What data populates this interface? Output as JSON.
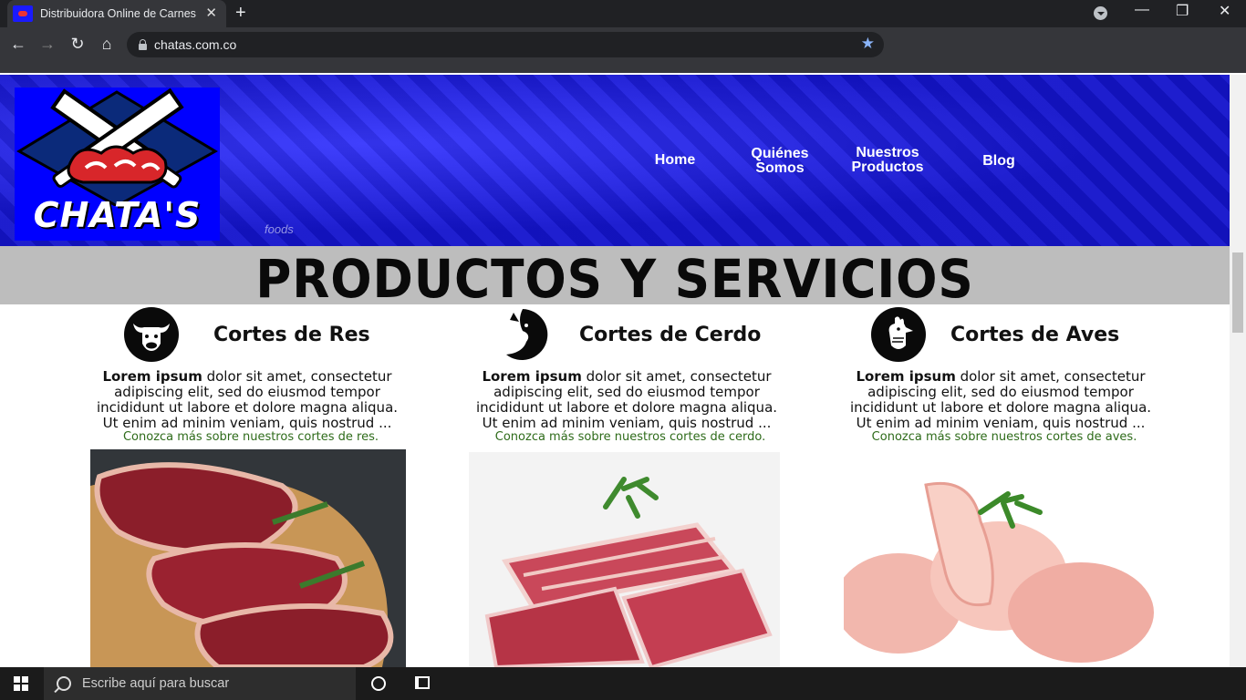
{
  "browser": {
    "tab_title": "Distribuidora Online de Carnes",
    "tab_close": "✕",
    "new_tab": "+",
    "url": "chatas.com.co",
    "window_controls": {
      "minimize": "—",
      "maximize": "❐",
      "close": "✕"
    }
  },
  "site": {
    "logo_text": "CHATA'S",
    "nav": [
      {
        "label": "Home"
      },
      {
        "label": "Quiénes\nSomos"
      },
      {
        "label": "Nuestros\nProductos"
      },
      {
        "label": "Blog"
      }
    ],
    "hero_ghost_text": "foods",
    "section_title": "PRODUCTOS Y SERVICIOS",
    "cards": [
      {
        "title": "Cortes de Res",
        "icon": "cow-icon",
        "desc_bold": "Lorem ipsum",
        "desc": " dolor sit amet, consectetur adipiscing elit, sed do eiusmod tempor incididunt ut labore et dolore magna aliqua. Ut enim ad minim veniam, quis nostrud ...",
        "link": "Conozca más sobre nuestros cortes de res."
      },
      {
        "title": "Cortes de Cerdo",
        "icon": "pig-icon",
        "desc_bold": "Lorem ipsum",
        "desc": " dolor sit amet, consectetur adipiscing elit, sed do eiusmod tempor incididunt ut labore et dolore magna aliqua. Ut enim ad minim veniam, quis nostrud ...",
        "link": "Conozca más sobre nuestros cortes de cerdo."
      },
      {
        "title": "Cortes de Aves",
        "icon": "rooster-icon",
        "desc_bold": "Lorem ipsum",
        "desc": " dolor sit amet, consectetur adipiscing elit, sed do eiusmod tempor incididunt ut labore et dolore magna aliqua. Ut enim ad minim veniam, quis nostrud ...",
        "link": "Conozca más sobre nuestros cortes de aves."
      }
    ]
  },
  "taskbar": {
    "search_placeholder": "Escribe aquí para buscar"
  },
  "colors": {
    "hero_blue": "#1f1fff",
    "banner_gray": "#bdbdbd",
    "link_green": "#2e6b1a",
    "bookmark_star": "#8ab4f8"
  }
}
